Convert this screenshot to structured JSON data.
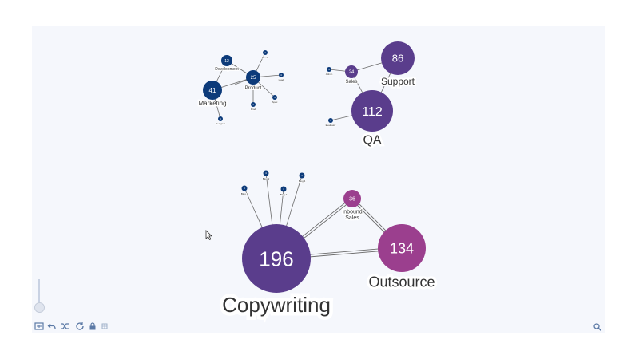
{
  "graph": {
    "nodes": [
      {
        "id": "development",
        "label": "Development",
        "value": "12",
        "kind": "dept"
      },
      {
        "id": "product",
        "label": "Product",
        "value": "25",
        "kind": "dept"
      },
      {
        "id": "marketing",
        "label": "Marketing",
        "value": "41",
        "kind": "dept"
      },
      {
        "id": "prod-s1",
        "label": "Dir - A",
        "value": "4",
        "kind": "person"
      },
      {
        "id": "prod-s2",
        "label": "Lead",
        "value": "4",
        "kind": "person"
      },
      {
        "id": "prod-s3",
        "label": "Prod",
        "value": "4",
        "kind": "person"
      },
      {
        "id": "prod-s4",
        "label": "Spec",
        "value": "4",
        "kind": "person"
      },
      {
        "id": "prod-s5",
        "label": "Ops",
        "value": "4",
        "kind": "person"
      },
      {
        "id": "mkt-s1",
        "label": "Designer",
        "value": "4",
        "kind": "person"
      },
      {
        "id": "sales",
        "label": "Sales",
        "value": "24",
        "kind": "team"
      },
      {
        "id": "support",
        "label": "Support",
        "value": "86",
        "kind": "team"
      },
      {
        "id": "qa",
        "label": "QA",
        "value": "112",
        "kind": "team"
      },
      {
        "id": "sales-s1",
        "label": "Admin",
        "value": "4",
        "kind": "person"
      },
      {
        "id": "qa-s1",
        "label": "Evaluator",
        "value": "4",
        "kind": "person"
      },
      {
        "id": "copywriting",
        "label": "Copywriting",
        "value": "196",
        "kind": "team"
      },
      {
        "id": "inbound",
        "label": "Inbound Sales",
        "value": "36",
        "kind": "team"
      },
      {
        "id": "outsource",
        "label": "Outsource",
        "value": "134",
        "kind": "team"
      },
      {
        "id": "copy-s1",
        "label": "Blog 1",
        "value": "4",
        "kind": "person"
      },
      {
        "id": "copy-s2",
        "label": "Blog 2",
        "value": "4",
        "kind": "person"
      },
      {
        "id": "copy-s3",
        "label": "Blog 3",
        "value": "4",
        "kind": "person"
      },
      {
        "id": "copy-s4",
        "label": "Blog 4",
        "value": "4",
        "kind": "person"
      }
    ],
    "edges": [
      [
        "development",
        "product"
      ],
      [
        "marketing",
        "product"
      ],
      [
        "marketing",
        "development"
      ],
      [
        "product",
        "prod-s1"
      ],
      [
        "product",
        "prod-s2"
      ],
      [
        "product",
        "prod-s3"
      ],
      [
        "product",
        "prod-s4"
      ],
      [
        "product",
        "prod-s5"
      ],
      [
        "marketing",
        "mkt-s1"
      ],
      [
        "sales",
        "support"
      ],
      [
        "sales",
        "qa"
      ],
      [
        "sales",
        "sales-s1"
      ],
      [
        "qa",
        "support"
      ],
      [
        "qa",
        "qa-s1"
      ],
      [
        "copywriting",
        "copy-s1"
      ],
      [
        "copywriting",
        "copy-s2"
      ],
      [
        "copywriting",
        "copy-s3"
      ],
      [
        "copywriting",
        "copy-s4"
      ],
      [
        "copywriting",
        "inbound"
      ],
      [
        "copywriting",
        "outsource"
      ],
      [
        "inbound",
        "outsource"
      ]
    ],
    "colors": {
      "dept": "#0d3b7a",
      "person": "#0d3b7a",
      "purple": "#5a3d8c",
      "magenta": "#9b3f8e",
      "edge": "#6b6b6b"
    }
  },
  "toolbar": {
    "icons": [
      "fit-icon",
      "undo-icon",
      "shuffle-icon",
      "refresh-icon",
      "lock-icon",
      "grid-icon"
    ]
  }
}
